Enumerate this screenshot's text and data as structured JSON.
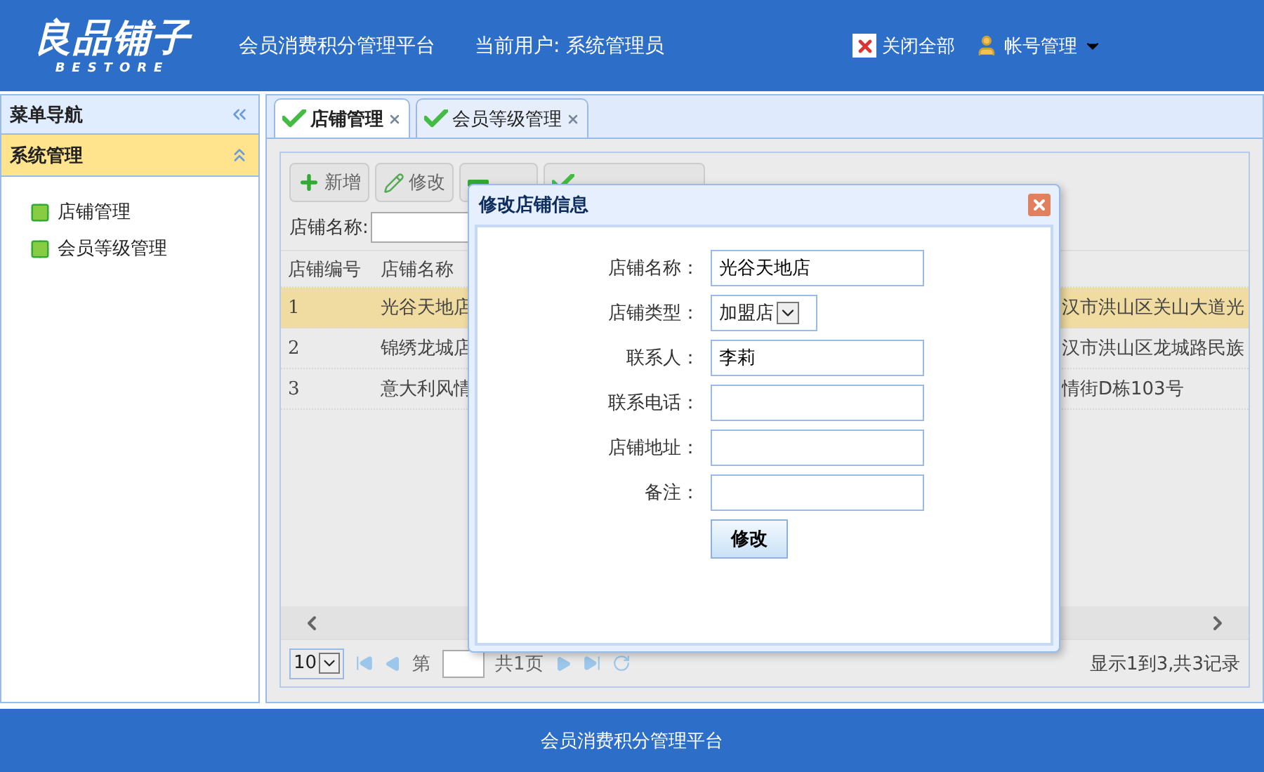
{
  "header": {
    "logo": {
      "name": "良品铺子",
      "sub": "BESTORE"
    },
    "app_title": "会员消费积分管理平台",
    "current_user": "当前用户: 系统管理员",
    "actions": [
      {
        "label": "关闭全部",
        "kind": "close"
      },
      {
        "label": "帐号管理",
        "kind": "account"
      }
    ]
  },
  "sidebar": {
    "title": "菜单导航",
    "groups": [
      {
        "title": "系统管理",
        "expanded": true,
        "items": [
          {
            "label": "店铺管理",
            "selected": false
          },
          {
            "label": "会员等级管理",
            "selected": false
          }
        ]
      }
    ]
  },
  "tabs": [
    {
      "label": "店铺管理",
      "selected": true
    },
    {
      "label": "会员等级管理",
      "selected": false
    }
  ],
  "toolbar": {
    "buttons": [
      {
        "label": "新增",
        "kind": "add"
      },
      {
        "label": "修改",
        "kind": "edit"
      },
      {
        "kind": "delete"
      },
      {
        "kind": "assign"
      }
    ]
  },
  "search": {
    "label": "店铺名称:"
  },
  "table": {
    "columns": [
      "店铺编号",
      "店铺名称"
    ],
    "rows": [
      {
        "cells": [
          "1",
          "光谷天地店",
          "汉市洪山区关山大道光"
        ],
        "selected": true
      },
      {
        "cells": [
          "2",
          "锦绣龙城店",
          "汉市洪山区龙城路民族"
        ],
        "selected": false
      },
      {
        "cells": [
          "3",
          "意大利风情",
          "情街D栋103号"
        ],
        "selected": false
      }
    ]
  },
  "pager": {
    "page_size": "10",
    "page_prefix": "第",
    "page_suffix": "共1页",
    "summary": "显示1到3,共3记录"
  },
  "dialog": {
    "title": "修改店铺信息",
    "fields": [
      {
        "label": "店铺名称：",
        "kind": "text",
        "value": "光谷天地店"
      },
      {
        "label": "店铺类型：",
        "kind": "select",
        "value": "加盟店"
      },
      {
        "label": "联系人：",
        "kind": "text",
        "value": "李莉"
      },
      {
        "label": "联系电话：",
        "kind": "text"
      },
      {
        "label": "店铺地址：",
        "kind": "text"
      },
      {
        "label": "备注：",
        "kind": "text"
      }
    ],
    "submit": "修改"
  },
  "footer": {
    "text": "会员消费积分管理平台"
  }
}
